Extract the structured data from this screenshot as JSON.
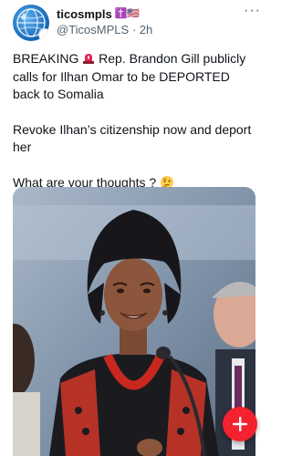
{
  "tweet": {
    "author": {
      "display_name": "ticosmpls",
      "flag": "✝️🇺🇸",
      "handle": "@TicosMPLS",
      "separator": "·",
      "time": "2h",
      "avatar": "globe-avatar"
    },
    "more_icon": "more-horizontal-icon",
    "text": {
      "line1_start": "BREAKING",
      "line1_rest": "Rep. Brandon Gill publicly calls for Ilhan Omar to be DEPORTED back to Somalia",
      "line2": "Revoke Ilhan’s  citizenship now and deport her",
      "line3": "What are your thoughts ?"
    },
    "media": {
      "description": "photo of a woman in a black headscarf and red necklace speaking at a microphone"
    }
  },
  "fab": {
    "icon": "plus-icon",
    "color": "#f4212e"
  },
  "colors": {
    "text": "#0f1419",
    "secondary": "#536471",
    "accent": "#f4212e"
  }
}
